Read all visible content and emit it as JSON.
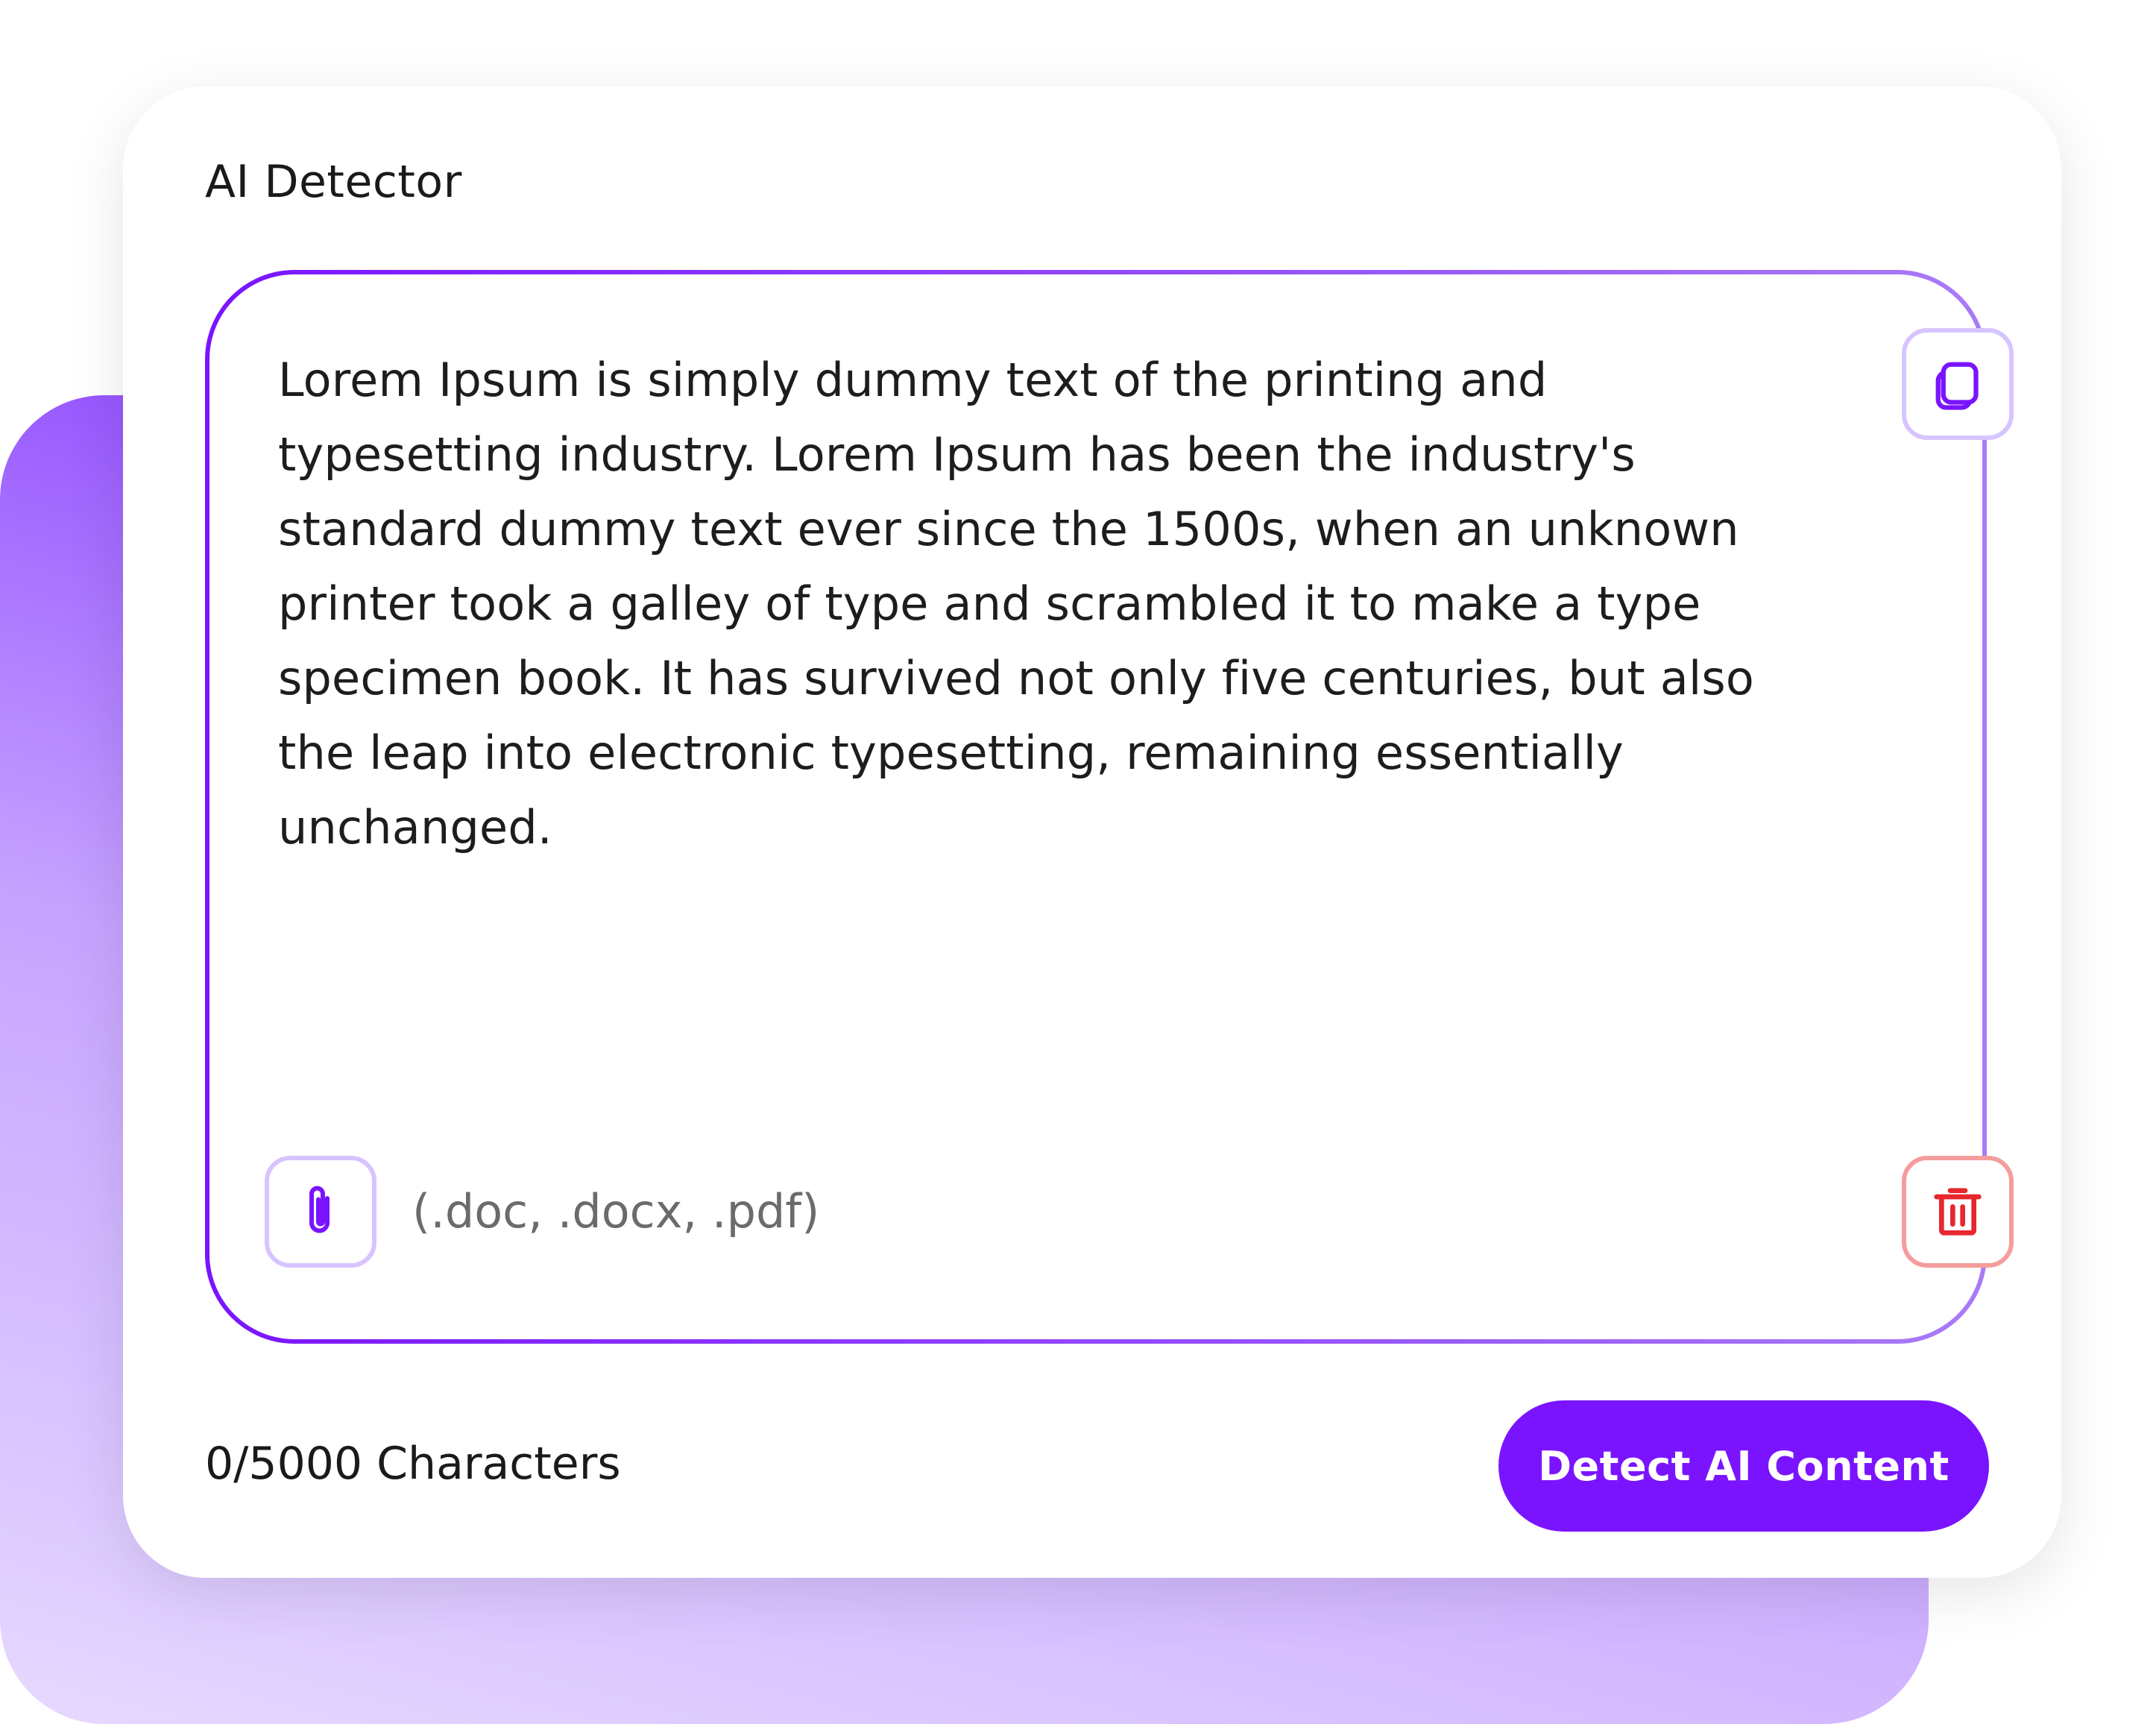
{
  "app": {
    "title": "AI Detector"
  },
  "editor": {
    "text": "Lorem Ipsum is simply dummy text of the printing and typesetting industry. Lorem Ipsum has been the industry's standard dummy text ever since the 1500s, when an unknown printer took a galley of type and scrambled it to make a type specimen book. It has survived not only five centuries, but also the leap into electronic typesetting, remaining essentially unchanged.",
    "file_types": "(.doc, .docx, .pdf)",
    "copy_icon": "copy-icon",
    "attach_icon": "paperclip-icon",
    "delete_icon": "trash-icon"
  },
  "footer": {
    "char_count": "0/5000 Characters",
    "detect_label": "Detect AI Content"
  },
  "colors": {
    "accent": "#7a14ff",
    "accent_light_border": "#d7c4ff",
    "danger": "#e8262e",
    "danger_light_border": "#f59c9c"
  }
}
